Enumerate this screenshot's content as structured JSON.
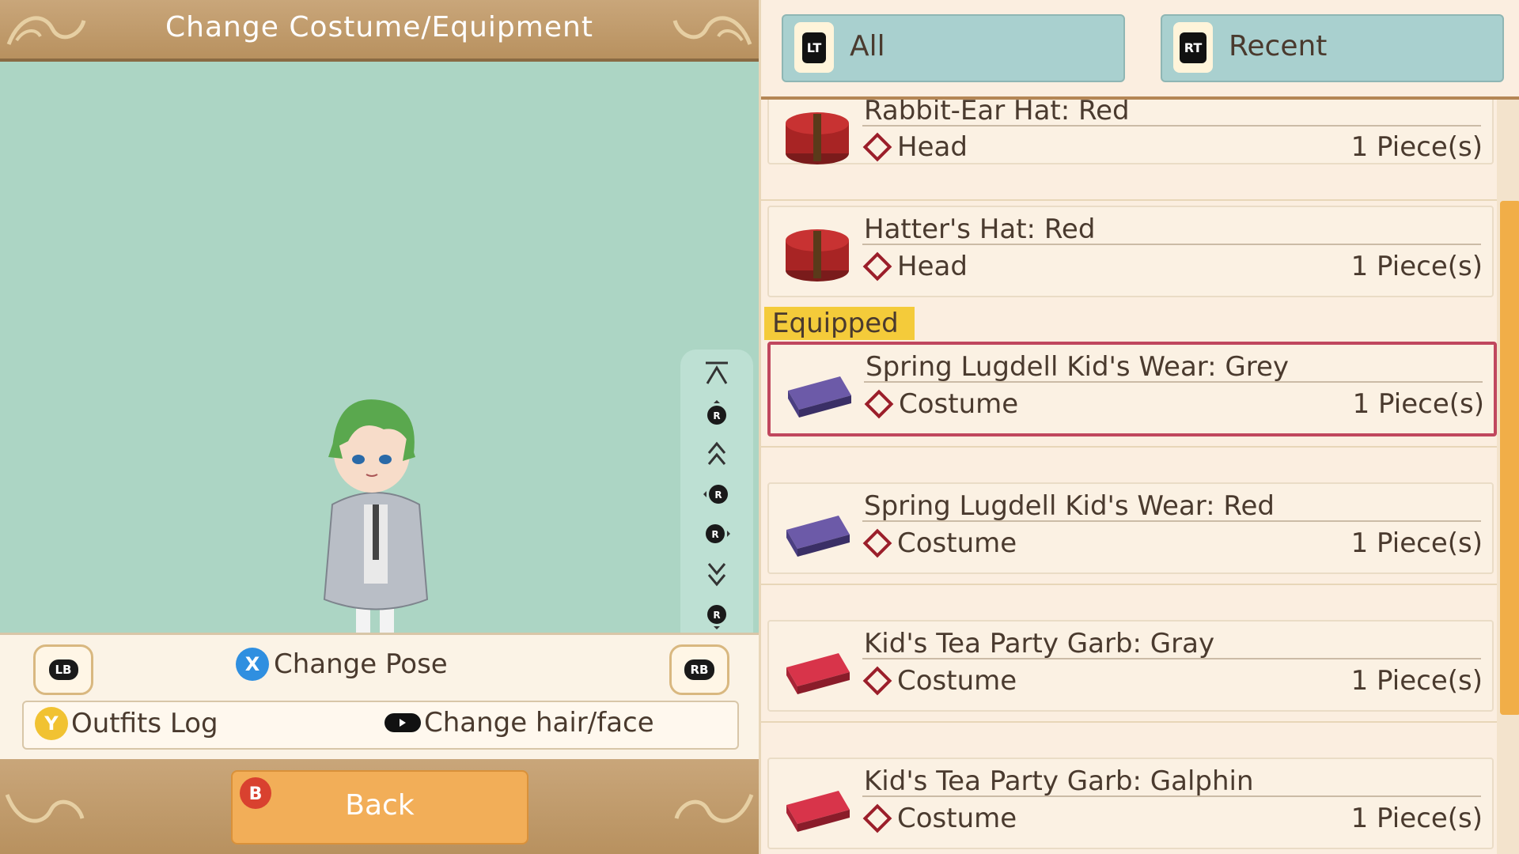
{
  "header": {
    "title": "Change Costume/Equipment"
  },
  "controls": {
    "lb": "LB",
    "rb": "RB",
    "x_glyph": "X",
    "change_pose": "Change Pose",
    "y_glyph": "Y",
    "outfits_log": "Outfits Log",
    "change_hair_face": "Change hair/face"
  },
  "footer": {
    "b_glyph": "B",
    "back": "Back"
  },
  "camera": {
    "icons": [
      "scroll-top-icon",
      "rotate-up-icon",
      "zoom-in-icon",
      "rotate-left-icon",
      "rotate-right-icon",
      "zoom-out-icon",
      "rotate-down-icon",
      "scroll-bottom-icon"
    ],
    "stick_glyph": "R"
  },
  "tabs": [
    {
      "badge": "LT",
      "label": "All"
    },
    {
      "badge": "RT",
      "label": "Recent"
    }
  ],
  "section": {
    "equipped_label": "Equipped"
  },
  "items": [
    {
      "name": "Rabbit-Ear Hat: Red",
      "category": "Head",
      "quantity": "1 Piece(s)",
      "icon": "red-hatbox-icon"
    },
    {
      "name": "Hatter's Hat: Red",
      "category": "Head",
      "quantity": "1 Piece(s)",
      "icon": "red-hatbox-icon"
    },
    {
      "name": "Spring Lugdell Kid's Wear: Grey",
      "category": "Costume",
      "quantity": "1 Piece(s)",
      "icon": "purple-suitcase-icon",
      "equipped": true
    },
    {
      "name": "Spring Lugdell Kid's Wear: Red",
      "category": "Costume",
      "quantity": "1 Piece(s)",
      "icon": "purple-suitcase-icon"
    },
    {
      "name": "Kid's Tea Party Garb: Gray",
      "category": "Costume",
      "quantity": "1 Piece(s)",
      "icon": "red-suitcase-icon"
    },
    {
      "name": "Kid's Tea Party Garb: Galphin",
      "category": "Costume",
      "quantity": "1 Piece(s)",
      "icon": "red-suitcase-icon"
    }
  ],
  "colors": {
    "accent": "#f1ae48",
    "equipped_border": "#c0475e",
    "viewer_bg": "#acd5c4"
  }
}
